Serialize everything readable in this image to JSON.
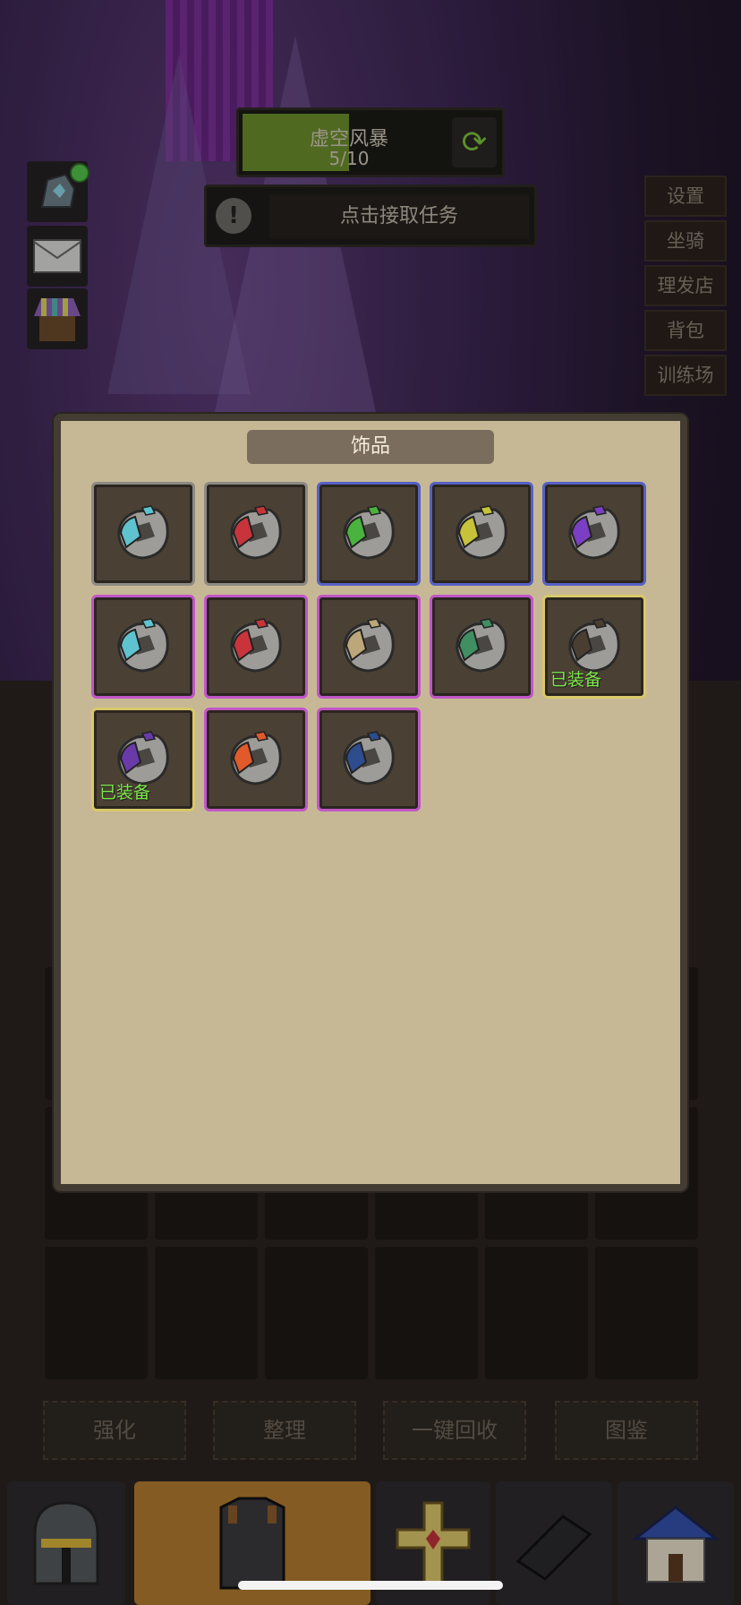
{
  "quest": {
    "title": "虚空风暴",
    "progress_text": "5/10",
    "progress_fraction": 0.5
  },
  "task": {
    "label": "点击接取任务",
    "alert_glyph": "!"
  },
  "right_menu": [
    "设置",
    "坐骑",
    "理发店",
    "背包",
    "训练场"
  ],
  "panel": {
    "title": "饰品"
  },
  "accessories": [
    {
      "rarity": "grey",
      "gem_color": "#5fc3cf",
      "icon": "ring-icon",
      "equipped": false
    },
    {
      "rarity": "grey",
      "gem_color": "#c9343c",
      "icon": "ring-icon",
      "equipped": false
    },
    {
      "rarity": "blue",
      "gem_color": "#4ab33e",
      "icon": "ring-icon",
      "equipped": false
    },
    {
      "rarity": "blue",
      "gem_color": "#c6c23a",
      "icon": "ring-icon",
      "equipped": false
    },
    {
      "rarity": "blue",
      "gem_color": "#7a3fc4",
      "icon": "ring-icon",
      "equipped": false
    },
    {
      "rarity": "purple",
      "gem_color": "#5fc3cf",
      "icon": "ring-icon",
      "equipped": false
    },
    {
      "rarity": "purple",
      "gem_color": "#c9343c",
      "icon": "ring-icon",
      "equipped": false
    },
    {
      "rarity": "purple",
      "gem_color": "#bca77a",
      "icon": "ring-icon",
      "equipped": false
    },
    {
      "rarity": "purple",
      "gem_color": "#3f8f62",
      "icon": "ring-icon",
      "equipped": false
    },
    {
      "rarity": "gold",
      "gem_color": "#4a3e32",
      "icon": "ring-icon",
      "equipped": true
    },
    {
      "rarity": "gold",
      "gem_color": "#6a3aa8",
      "icon": "ring-icon",
      "equipped": true
    },
    {
      "rarity": "purple",
      "gem_color": "#e05a2a",
      "icon": "ring-icon",
      "equipped": false
    },
    {
      "rarity": "purple",
      "gem_color": "#2d4d8e",
      "icon": "ring-icon",
      "equipped": false
    }
  ],
  "equipped_label": "已装备",
  "actions": [
    "强化",
    "整理",
    "一键回收",
    "图鉴"
  ],
  "nav_tabs": [
    {
      "icon": "helmet-icon",
      "active": false
    },
    {
      "icon": "armor-icon",
      "active": true
    },
    {
      "icon": "cross-icon",
      "active": false
    },
    {
      "icon": "boots-icon",
      "active": false
    },
    {
      "icon": "house-icon",
      "active": false
    }
  ]
}
